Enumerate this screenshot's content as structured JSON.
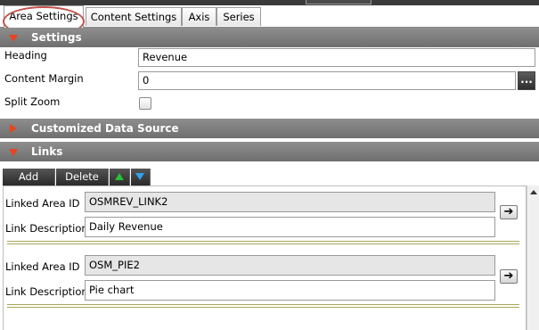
{
  "tabs": [
    {
      "label": "Area Settings"
    },
    {
      "label": "Content Settings"
    },
    {
      "label": "Axis"
    },
    {
      "label": "Series"
    }
  ],
  "sections": {
    "settings": "Settings",
    "customized": "Customized Data Source",
    "links": "Links"
  },
  "settings": {
    "heading_label": "Heading",
    "heading_value": "Revenue",
    "margin_label": "Content Margin",
    "margin_value": "0",
    "margin_button": "...",
    "splitzoom_label": "Split Zoom",
    "splitzoom_checked": false
  },
  "toolbar": {
    "add": "Add",
    "delete": "Delete"
  },
  "links": [
    {
      "area_label": "Linked Area ID",
      "area_id": "OSMREV_LINK2",
      "desc_label": "Link Description",
      "description": "Daily Revenue",
      "go": "➔"
    },
    {
      "area_label": "Linked Area ID",
      "area_id": "OSM_PIE2",
      "desc_label": "Link Description",
      "description": "Pie chart",
      "go": "➔"
    }
  ],
  "colors": {
    "section_bg": "#7d7d7d",
    "expander": "#e8441f",
    "highlight_ring": "#c2504a",
    "move_up": "#27c03a",
    "move_down": "#2fa3ee"
  }
}
